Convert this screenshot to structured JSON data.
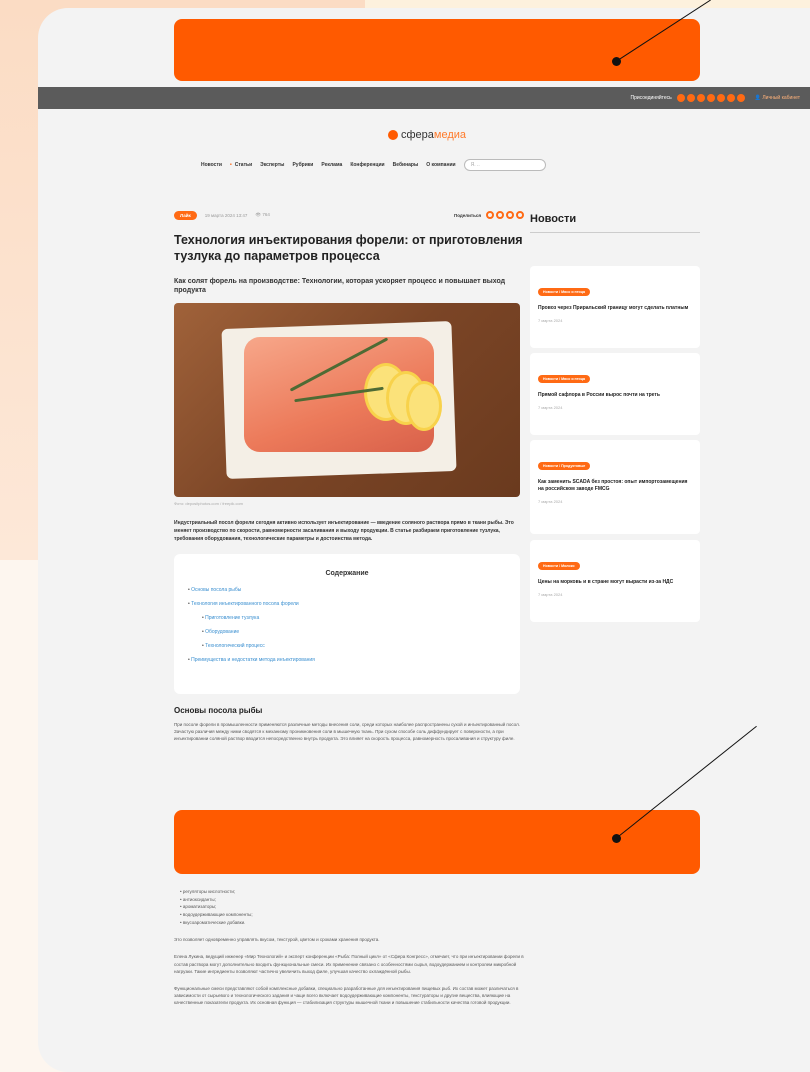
{
  "topbar": {
    "join_label": "Присоединяйтесь",
    "social_icons": [
      "vk-icon",
      "telegram-icon",
      "ok-icon",
      "dzen-icon",
      "youtube-icon",
      "rutube-icon",
      "rss-icon"
    ],
    "cabinet_label": "Личный кабинет"
  },
  "logo": {
    "part1": "сфера",
    "part2": "медиа"
  },
  "nav": {
    "items": [
      "Новости",
      "Статьи",
      "Эксперты",
      "Рубрики",
      "Реклама",
      "Конференции",
      "Вебинары",
      "О компании"
    ],
    "search_placeholder": "Я. .."
  },
  "article": {
    "tag": "Лайк",
    "date": "19 марта 2024 13:47",
    "views": "764",
    "share_label": "Поделиться",
    "title": "Технология инъектирования форели: от приготовления тузлука до параметров процесса",
    "subtitle": "Как солят форель на производстве: Технологии, которая ускоряет процесс и повышает выход продукта",
    "photo_caption": "Фото: depositphotos.com / freepik.com",
    "lead": "Индустриальный посол форели сегодня активно использует инъектирование — введение соляного раствора прямо в ткани рыбы. Это меняет производство по скорости, равномерности засаливания и выходу продукции. В статье разбираем приготовление тузлука, требования оборудования, технологические параметры и достоинства метода."
  },
  "toc": {
    "title": "Содержание",
    "items": [
      {
        "label": "Основы посола рыбы",
        "sub": false
      },
      {
        "label": "Технология инъектированного посола форели",
        "sub": false
      },
      {
        "label": "Приготовление тузлука",
        "sub": true
      },
      {
        "label": "Оборудование",
        "sub": true
      },
      {
        "label": "Технологический процесс",
        "sub": true
      },
      {
        "label": "Преимущества и недостатки метода инъектирования",
        "sub": false
      }
    ]
  },
  "section1": {
    "title": "Основы посола рыбы",
    "para": "При посоле форели в промышленности применяются различные методы внесения соли, среди которых наиболее распространены сухой и инъектированный посол. Зачастую различия между ними сводятся к механизму проникновения соли в мышечную ткань. При сухом способе соль диффундирует с поверхности, а при инъектировании соляной раствор вводится непосредственно внутрь продукта. Это влияет на скорость процесса, равномерность просаливания и структуру филе."
  },
  "lower": {
    "list": [
      "регуляторы кислотности;",
      "антиоксиданты;",
      "ароматизаторы;",
      "водоудерживающие компоненты;",
      "вкусоароматические добавки."
    ],
    "para1": "Это позволяет одновременно управлять вкусом, текстурой, цветом и сроками хранения продукта.",
    "para2": "Елена Лукина, ведущий инженер «Мир Технологий» и эксперт конференции «Рыба: Полный цикл» от «Сфера Конгресс», отмечает, что при инъектировании форели в состав раствора могут дополнительно входить функциональные смеси. Их применение связано с особенностями сырья, водоудержанием и контролем микробной нагрузки. Такие ингредиенты позволяют частично увеличить выход филе, улучшая качество охлаждённой рыбы.",
    "para3": "Функциональные смеси представляют собой комплексные добавки, специально разработанные для инъектирования пищевых рыб. Их состав может различаться в зависимости от сырьевого и технологического задания и чаще всего включает водоудерживающие компоненты, текстураторы и другие вещества, влияющие на качественные показатели продукта. Их основная функция — стабилизация структуры мышечной ткани и повышение стабильности качества готовой продукции."
  },
  "sidebar": {
    "heading": "Новости",
    "news": [
      {
        "tag": "Новости / Мясо и птица",
        "title": "Провоз через Приральский границу могут сделать платным",
        "date": "7 марта 2024"
      },
      {
        "tag": "Новости / Мясо и птица",
        "title": "Прямой сафлора в России вырос почти на треть",
        "date": "7 марта 2024"
      },
      {
        "tag": "Новости / Продуктовые",
        "title": "Как заменить SCADA без простоя: опыт импортозамещения на российском заводе FMCG",
        "date": "7 марта 2024"
      },
      {
        "tag": "Новости / Молоко",
        "title": "Цены на морковь и в стране могут вырасти из-за НДС",
        "date": "7 марта 2024"
      }
    ]
  },
  "colors": {
    "accent": "#ff5a00",
    "link": "#3a8fd0",
    "topbar": "#5b5b5b"
  }
}
